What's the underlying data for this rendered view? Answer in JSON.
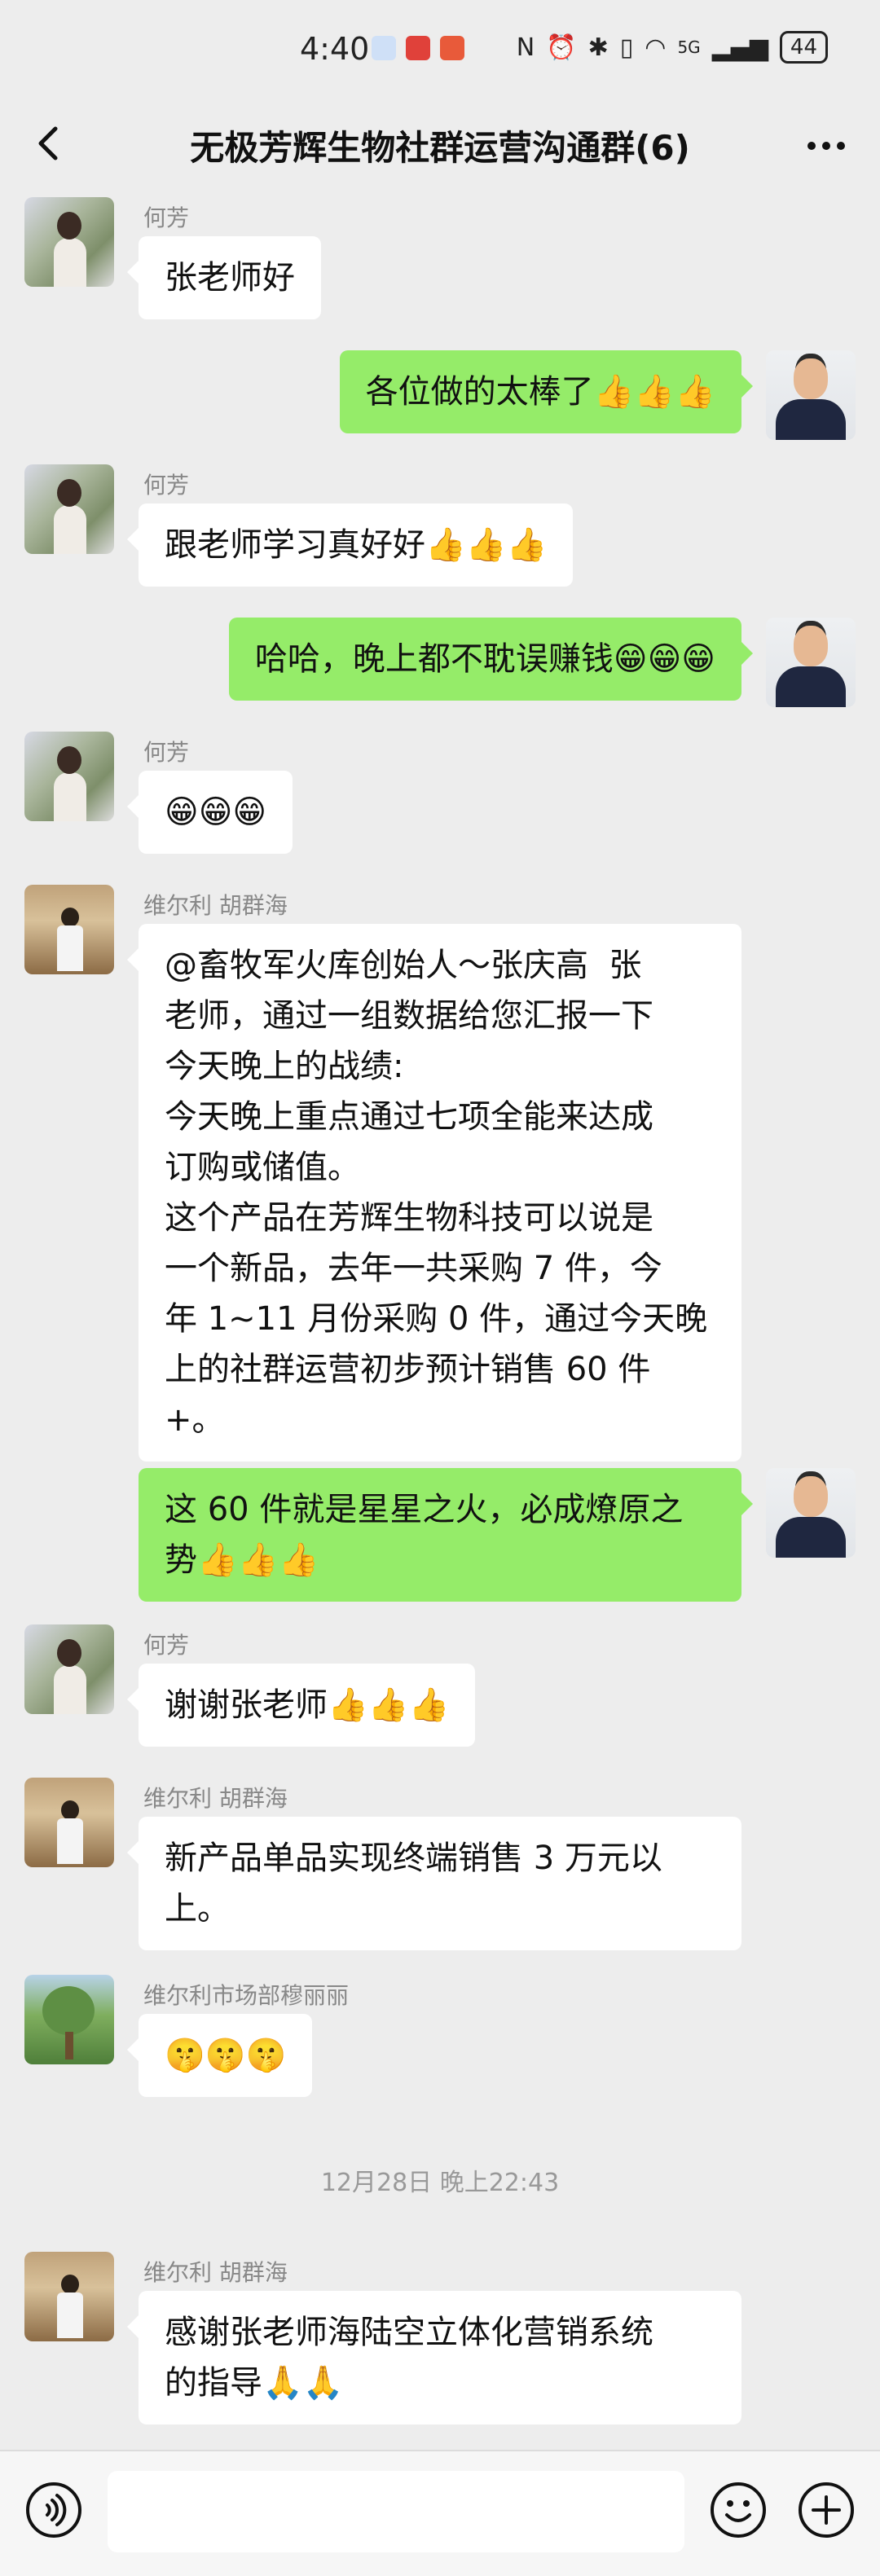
{
  "status_bar": {
    "time": "4:40",
    "network": "5G",
    "battery": "44"
  },
  "header": {
    "title": "无极芳辉生物社群运营沟通群(6)"
  },
  "messages": [
    {
      "sender": "何芳",
      "text": "张老师好"
    },
    {
      "text": "各位做的太棒了👍👍👍"
    },
    {
      "sender": "何芳",
      "text": "跟老师学习真好好👍👍👍"
    },
    {
      "text": "哈哈，晚上都不耽误赚钱😁😁😁"
    },
    {
      "sender": "何芳",
      "text": "😁😁😁"
    },
    {
      "sender": "维尔利 胡群海",
      "text": "@畜牧军火库创始人～张庆高  张\n老师，通过一组数据给您汇报一下\n今天晚上的战绩:\n今天晚上重点通过七项全能来达成\n订购或储值。\n这个产品在芳辉生物科技可以说是\n一个新品，去年一共采购 7 件，今\n年 1~11 月份采购 0 件，通过今天晚\n上的社群运营初步预计销售 60 件\n+。"
    },
    {
      "text": "这 60 件就是星星之火，必成燎原之\n势👍👍👍"
    },
    {
      "sender": "何芳",
      "text": "谢谢张老师👍👍👍"
    },
    {
      "sender": "维尔利 胡群海",
      "text": "新产品单品实现终端销售 3 万元以\n上。"
    },
    {
      "sender": "维尔利市场部穆丽丽",
      "text": "🤫🤫🤫"
    },
    {
      "sender": "维尔利 胡群海",
      "text": "感谢张老师海陆空立体化营销系统\n的指导🙏🙏"
    }
  ],
  "time_divider": "12月28日 晚上22:43",
  "colors": {
    "background": "#ededed",
    "incoming_bubble": "#ffffff",
    "outgoing_bubble": "#95ec69",
    "sender_name": "#888888"
  }
}
